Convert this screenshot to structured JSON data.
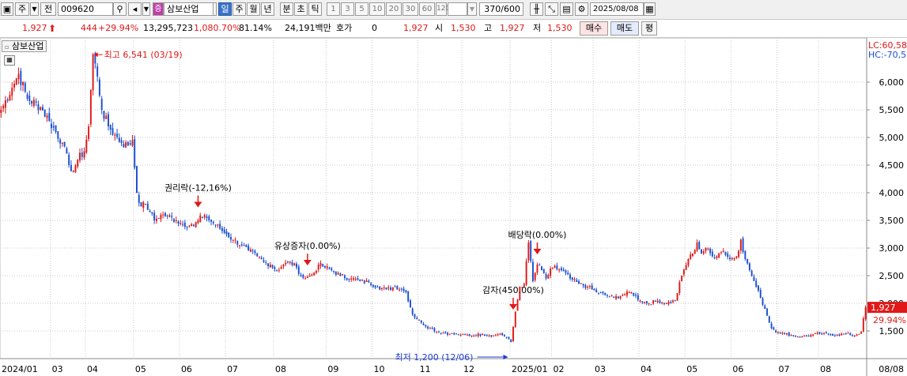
{
  "toolbar": {
    "market": "주",
    "mode": "전",
    "code": "009620",
    "stock_name": "삼보산업",
    "stock_badge": "증",
    "periods": [
      "일",
      "주",
      "월",
      "년",
      "분",
      "초",
      "틱"
    ],
    "selected_period": "일",
    "intervals": [
      "1",
      "3",
      "5",
      "10",
      "20",
      "30",
      "60",
      "120"
    ],
    "count": "370/600",
    "date": "2025/08/08"
  },
  "quote": {
    "price": "1,927",
    "change": "444",
    "change_pct": "+29.94%",
    "volume": "13,295,723",
    "vol_ratio": "1,080.70%",
    "turnover": "81.14%",
    "amount": "24,191백만",
    "hoga_label": "호가",
    "hoga_value": "0",
    "hoga_price": "1,927",
    "open_label": "시",
    "open": "1,530",
    "high_label": "고",
    "high": "1,927",
    "low_label": "저",
    "low": "1,530",
    "buy_label": "매수",
    "sell_label": "매도",
    "eval_label": "평"
  },
  "colors": {
    "up": "#e01818",
    "down": "#1a4fd0",
    "grid": "#c8c8c8",
    "arrow_red": "#e01818",
    "arrow_blue": "#1a3ad8"
  },
  "chart_data": {
    "type": "candlestick",
    "title": "삼보산업",
    "ylim": [
      1000,
      6800
    ],
    "y_ticks": [
      1500,
      2000,
      2500,
      3000,
      3500,
      4000,
      4500,
      5000,
      5500,
      6000
    ],
    "y_tick_labels": [
      "1,500",
      "2,000",
      "2,500",
      "3,000",
      "3,500",
      "4,000",
      "4,500",
      "5,000",
      "5,500",
      "6,000"
    ],
    "x_tick_labels": [
      "2024/01",
      "03",
      "04",
      "05",
      "06",
      "07",
      "08",
      "09",
      "10",
      "11",
      "12",
      "2025/01",
      "02",
      "03",
      "04",
      "05",
      "06",
      "07",
      "08",
      "08/08"
    ],
    "x_tick_index": [
      0,
      23,
      39,
      61,
      82,
      103,
      125,
      149,
      170,
      191,
      211,
      233,
      252,
      271,
      292,
      313,
      334,
      355,
      374,
      395
    ],
    "n_days": 396,
    "series": [
      {
        "name": "close",
        "anchors": [
          [
            0,
            5500
          ],
          [
            5,
            5900
          ],
          [
            8,
            6150
          ],
          [
            12,
            5700
          ],
          [
            18,
            5550
          ],
          [
            22,
            5300
          ],
          [
            28,
            4900
          ],
          [
            31,
            4500
          ],
          [
            33,
            4400
          ],
          [
            35,
            4600
          ],
          [
            38,
            4750
          ],
          [
            40,
            5200
          ],
          [
            42,
            6500
          ],
          [
            44,
            6100
          ],
          [
            46,
            5500
          ],
          [
            49,
            5200
          ],
          [
            52,
            5050
          ],
          [
            55,
            4900
          ],
          [
            58,
            4850
          ],
          [
            60,
            4950
          ],
          [
            62,
            4000
          ],
          [
            64,
            3750
          ],
          [
            66,
            3800
          ],
          [
            68,
            3650
          ],
          [
            70,
            3500
          ],
          [
            73,
            3600
          ],
          [
            76,
            3580
          ],
          [
            80,
            3500
          ],
          [
            82,
            3450
          ],
          [
            88,
            3400
          ],
          [
            90,
            3500
          ],
          [
            93,
            3600
          ],
          [
            95,
            3500
          ],
          [
            97,
            3450
          ],
          [
            100,
            3350
          ],
          [
            103,
            3250
          ],
          [
            106,
            3150
          ],
          [
            110,
            3050
          ],
          [
            113,
            2950
          ],
          [
            117,
            2850
          ],
          [
            120,
            2750
          ],
          [
            123,
            2700
          ],
          [
            126,
            2600
          ],
          [
            129,
            2700
          ],
          [
            132,
            2750
          ],
          [
            135,
            2650
          ],
          [
            137,
            2500
          ],
          [
            139,
            2450
          ],
          [
            141,
            2500
          ],
          [
            143,
            2550
          ],
          [
            145,
            2700
          ],
          [
            148,
            2650
          ],
          [
            151,
            2600
          ],
          [
            155,
            2500
          ],
          [
            160,
            2450
          ],
          [
            164,
            2400
          ],
          [
            168,
            2380
          ],
          [
            172,
            2300
          ],
          [
            176,
            2250
          ],
          [
            180,
            2300
          ],
          [
            183,
            2250
          ],
          [
            185,
            2200
          ],
          [
            188,
            1800
          ],
          [
            192,
            1650
          ],
          [
            196,
            1550
          ],
          [
            200,
            1480
          ],
          [
            205,
            1450
          ],
          [
            210,
            1430
          ],
          [
            215,
            1420
          ],
          [
            220,
            1440
          ],
          [
            225,
            1420
          ],
          [
            228,
            1450
          ],
          [
            231,
            1380
          ],
          [
            233,
            1300
          ],
          [
            235,
            1850
          ],
          [
            237,
            2300
          ],
          [
            239,
            2350
          ],
          [
            241,
            3100
          ],
          [
            243,
            2400
          ],
          [
            245,
            2700
          ],
          [
            247,
            2600
          ],
          [
            249,
            2450
          ],
          [
            252,
            2650
          ],
          [
            256,
            2600
          ],
          [
            260,
            2450
          ],
          [
            264,
            2350
          ],
          [
            268,
            2300
          ],
          [
            272,
            2200
          ],
          [
            276,
            2150
          ],
          [
            280,
            2100
          ],
          [
            284,
            2150
          ],
          [
            288,
            2200
          ],
          [
            292,
            2050
          ],
          [
            296,
            2000
          ],
          [
            300,
            2050
          ],
          [
            304,
            2000
          ],
          [
            308,
            2050
          ],
          [
            311,
            2500
          ],
          [
            314,
            2800
          ],
          [
            316,
            2900
          ],
          [
            318,
            3100
          ],
          [
            320,
            2900
          ],
          [
            322,
            3000
          ],
          [
            325,
            2850
          ],
          [
            328,
            2900
          ],
          [
            330,
            2950
          ],
          [
            333,
            2800
          ],
          [
            336,
            2850
          ],
          [
            338,
            3150
          ],
          [
            340,
            2800
          ],
          [
            342,
            2600
          ],
          [
            345,
            2300
          ],
          [
            347,
            2100
          ],
          [
            349,
            1900
          ],
          [
            352,
            1550
          ],
          [
            355,
            1480
          ],
          [
            358,
            1450
          ],
          [
            362,
            1420
          ],
          [
            366,
            1400
          ],
          [
            370,
            1430
          ],
          [
            374,
            1450
          ],
          [
            378,
            1440
          ],
          [
            382,
            1430
          ],
          [
            386,
            1450
          ],
          [
            390,
            1420
          ],
          [
            393,
            1483
          ],
          [
            395,
            1927
          ]
        ]
      }
    ],
    "annotations": [
      {
        "text": "최고 6,541 (03/19)",
        "index": 42,
        "value": 6541,
        "kind": "high"
      },
      {
        "text": "권리락(-12,16%)",
        "index": 90,
        "value": 3750,
        "kind": "event"
      },
      {
        "text": "유상증자(0.00%)",
        "index": 140,
        "value": 2700,
        "kind": "event"
      },
      {
        "text": "감자(450.00%)",
        "index": 234,
        "value": 1900,
        "kind": "event"
      },
      {
        "text": "배당락(0.00%)",
        "index": 245,
        "value": 2900,
        "kind": "event"
      },
      {
        "text": "최저 1,200 (12/06)",
        "index": 232,
        "value": 1200,
        "kind": "low"
      }
    ],
    "right_labels": {
      "lc": "LC:60,58",
      "hc": "HC:-70,5",
      "last_price": "1,927",
      "last_pct": "29.94%"
    }
  }
}
